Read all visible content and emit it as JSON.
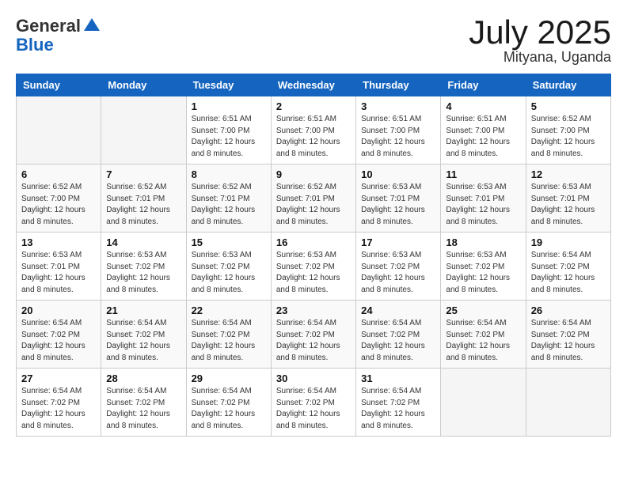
{
  "logo": {
    "general": "General",
    "blue": "Blue"
  },
  "header": {
    "month": "July 2025",
    "location": "Mityana, Uganda"
  },
  "weekdays": [
    "Sunday",
    "Monday",
    "Tuesday",
    "Wednesday",
    "Thursday",
    "Friday",
    "Saturday"
  ],
  "weeks": [
    [
      {
        "day": "",
        "info": ""
      },
      {
        "day": "",
        "info": ""
      },
      {
        "day": "1",
        "info": "Sunrise: 6:51 AM\nSunset: 7:00 PM\nDaylight: 12 hours and 8 minutes."
      },
      {
        "day": "2",
        "info": "Sunrise: 6:51 AM\nSunset: 7:00 PM\nDaylight: 12 hours and 8 minutes."
      },
      {
        "day": "3",
        "info": "Sunrise: 6:51 AM\nSunset: 7:00 PM\nDaylight: 12 hours and 8 minutes."
      },
      {
        "day": "4",
        "info": "Sunrise: 6:51 AM\nSunset: 7:00 PM\nDaylight: 12 hours and 8 minutes."
      },
      {
        "day": "5",
        "info": "Sunrise: 6:52 AM\nSunset: 7:00 PM\nDaylight: 12 hours and 8 minutes."
      }
    ],
    [
      {
        "day": "6",
        "info": "Sunrise: 6:52 AM\nSunset: 7:00 PM\nDaylight: 12 hours and 8 minutes."
      },
      {
        "day": "7",
        "info": "Sunrise: 6:52 AM\nSunset: 7:01 PM\nDaylight: 12 hours and 8 minutes."
      },
      {
        "day": "8",
        "info": "Sunrise: 6:52 AM\nSunset: 7:01 PM\nDaylight: 12 hours and 8 minutes."
      },
      {
        "day": "9",
        "info": "Sunrise: 6:52 AM\nSunset: 7:01 PM\nDaylight: 12 hours and 8 minutes."
      },
      {
        "day": "10",
        "info": "Sunrise: 6:53 AM\nSunset: 7:01 PM\nDaylight: 12 hours and 8 minutes."
      },
      {
        "day": "11",
        "info": "Sunrise: 6:53 AM\nSunset: 7:01 PM\nDaylight: 12 hours and 8 minutes."
      },
      {
        "day": "12",
        "info": "Sunrise: 6:53 AM\nSunset: 7:01 PM\nDaylight: 12 hours and 8 minutes."
      }
    ],
    [
      {
        "day": "13",
        "info": "Sunrise: 6:53 AM\nSunset: 7:01 PM\nDaylight: 12 hours and 8 minutes."
      },
      {
        "day": "14",
        "info": "Sunrise: 6:53 AM\nSunset: 7:02 PM\nDaylight: 12 hours and 8 minutes."
      },
      {
        "day": "15",
        "info": "Sunrise: 6:53 AM\nSunset: 7:02 PM\nDaylight: 12 hours and 8 minutes."
      },
      {
        "day": "16",
        "info": "Sunrise: 6:53 AM\nSunset: 7:02 PM\nDaylight: 12 hours and 8 minutes."
      },
      {
        "day": "17",
        "info": "Sunrise: 6:53 AM\nSunset: 7:02 PM\nDaylight: 12 hours and 8 minutes."
      },
      {
        "day": "18",
        "info": "Sunrise: 6:53 AM\nSunset: 7:02 PM\nDaylight: 12 hours and 8 minutes."
      },
      {
        "day": "19",
        "info": "Sunrise: 6:54 AM\nSunset: 7:02 PM\nDaylight: 12 hours and 8 minutes."
      }
    ],
    [
      {
        "day": "20",
        "info": "Sunrise: 6:54 AM\nSunset: 7:02 PM\nDaylight: 12 hours and 8 minutes."
      },
      {
        "day": "21",
        "info": "Sunrise: 6:54 AM\nSunset: 7:02 PM\nDaylight: 12 hours and 8 minutes."
      },
      {
        "day": "22",
        "info": "Sunrise: 6:54 AM\nSunset: 7:02 PM\nDaylight: 12 hours and 8 minutes."
      },
      {
        "day": "23",
        "info": "Sunrise: 6:54 AM\nSunset: 7:02 PM\nDaylight: 12 hours and 8 minutes."
      },
      {
        "day": "24",
        "info": "Sunrise: 6:54 AM\nSunset: 7:02 PM\nDaylight: 12 hours and 8 minutes."
      },
      {
        "day": "25",
        "info": "Sunrise: 6:54 AM\nSunset: 7:02 PM\nDaylight: 12 hours and 8 minutes."
      },
      {
        "day": "26",
        "info": "Sunrise: 6:54 AM\nSunset: 7:02 PM\nDaylight: 12 hours and 8 minutes."
      }
    ],
    [
      {
        "day": "27",
        "info": "Sunrise: 6:54 AM\nSunset: 7:02 PM\nDaylight: 12 hours and 8 minutes."
      },
      {
        "day": "28",
        "info": "Sunrise: 6:54 AM\nSunset: 7:02 PM\nDaylight: 12 hours and 8 minutes."
      },
      {
        "day": "29",
        "info": "Sunrise: 6:54 AM\nSunset: 7:02 PM\nDaylight: 12 hours and 8 minutes."
      },
      {
        "day": "30",
        "info": "Sunrise: 6:54 AM\nSunset: 7:02 PM\nDaylight: 12 hours and 8 minutes."
      },
      {
        "day": "31",
        "info": "Sunrise: 6:54 AM\nSunset: 7:02 PM\nDaylight: 12 hours and 8 minutes."
      },
      {
        "day": "",
        "info": ""
      },
      {
        "day": "",
        "info": ""
      }
    ]
  ]
}
